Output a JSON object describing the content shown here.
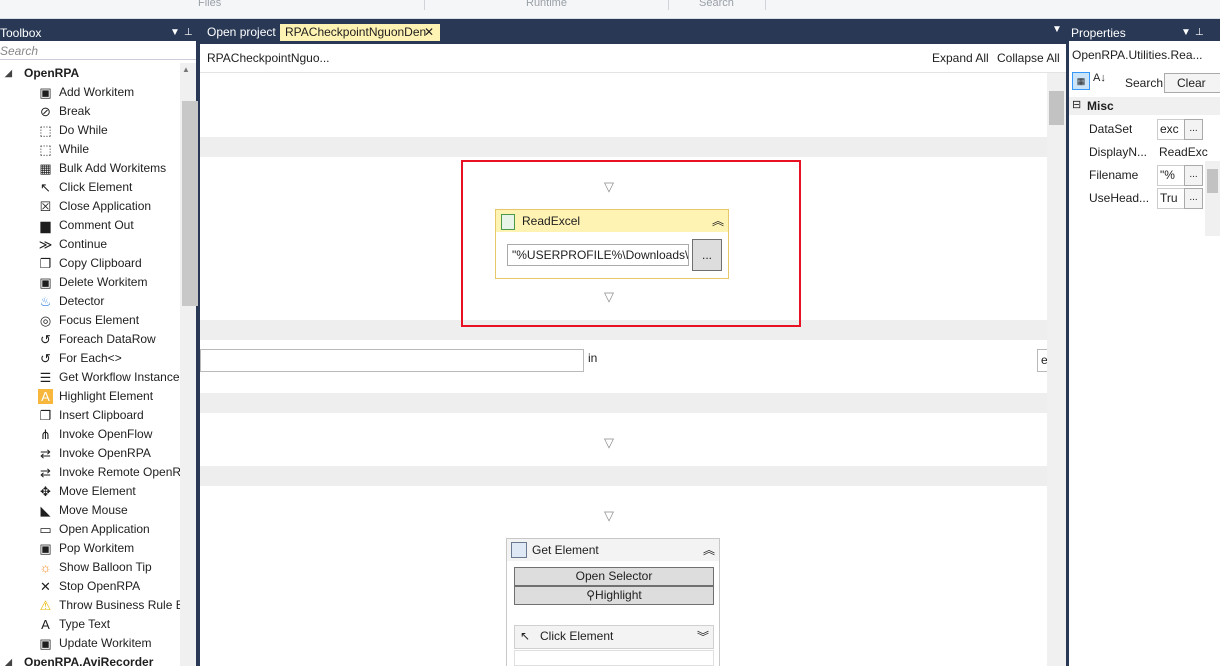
{
  "ribbon": {
    "groups": [
      "Files",
      "Runtime",
      "Search"
    ]
  },
  "toolbox": {
    "title": "Toolbox",
    "search_placeholder": "Search",
    "category": "OpenRPA",
    "next_category": "OpenRPA.AviRecorder",
    "items": [
      {
        "label": "Add Workitem",
        "icon": "add-workitem-icon"
      },
      {
        "label": "Break",
        "icon": "break-icon"
      },
      {
        "label": "Do While",
        "icon": "do-while-icon"
      },
      {
        "label": "While",
        "icon": "while-icon"
      },
      {
        "label": "Bulk Add Workitems",
        "icon": "bulk-add-icon"
      },
      {
        "label": "Click Element",
        "icon": "click-element-icon"
      },
      {
        "label": "Close Application",
        "icon": "close-application-icon"
      },
      {
        "label": "Comment Out",
        "icon": "comment-out-icon"
      },
      {
        "label": "Continue",
        "icon": "continue-icon"
      },
      {
        "label": "Copy Clipboard",
        "icon": "copy-clipboard-icon"
      },
      {
        "label": "Delete Workitem",
        "icon": "delete-workitem-icon"
      },
      {
        "label": "Detector",
        "icon": "detector-icon"
      },
      {
        "label": "Focus Element",
        "icon": "focus-element-icon"
      },
      {
        "label": "Foreach DataRow",
        "icon": "foreach-datarow-icon"
      },
      {
        "label": "For Each<>",
        "icon": "for-each-icon"
      },
      {
        "label": "Get Workflow Instance",
        "icon": "get-workflow-instance-icon"
      },
      {
        "label": "Highlight Element",
        "icon": "highlight-element-icon"
      },
      {
        "label": "Insert Clipboard",
        "icon": "insert-clipboard-icon"
      },
      {
        "label": "Invoke OpenFlow",
        "icon": "invoke-openflow-icon"
      },
      {
        "label": "Invoke OpenRPA",
        "icon": "invoke-openrpa-icon"
      },
      {
        "label": "Invoke Remote OpenRPA",
        "icon": "invoke-remote-openrpa-icon"
      },
      {
        "label": "Move Element",
        "icon": "move-element-icon"
      },
      {
        "label": "Move Mouse",
        "icon": "move-mouse-icon"
      },
      {
        "label": "Open Application",
        "icon": "open-application-icon"
      },
      {
        "label": "Pop Workitem",
        "icon": "pop-workitem-icon"
      },
      {
        "label": "Show Balloon Tip",
        "icon": "show-balloon-tip-icon"
      },
      {
        "label": "Stop OpenRPA",
        "icon": "stop-openrpa-icon"
      },
      {
        "label": "Throw Business Rule Exception",
        "icon": "warning-icon"
      },
      {
        "label": "Type Text",
        "icon": "type-text-icon"
      },
      {
        "label": "Update Workitem",
        "icon": "update-workitem-icon"
      }
    ]
  },
  "tabs": {
    "open_project": "Open project",
    "active": "RPACheckpointNguonDen",
    "close_glyph": "✕"
  },
  "designer": {
    "breadcrumb": "RPACheckpointNguo...",
    "expand_all": "Expand All",
    "collapse_all": "Collapse All",
    "foreach_in": "in",
    "foreach_right_value": "e",
    "read_excel": {
      "title": "ReadExcel",
      "filename": "\"%USERPROFILE%\\Downloads\\",
      "browse": "..."
    },
    "get_element": {
      "title": "Get Element",
      "open_selector": "Open Selector",
      "highlight": "Highlight"
    },
    "click_element": {
      "title": "Click Element"
    }
  },
  "properties": {
    "title": "Properties",
    "object": "OpenRPA.Utilities.Rea...",
    "search_label": "Search:",
    "clear": "Clear",
    "category": "Misc",
    "rows": [
      {
        "name": "DataSet",
        "value": "exc"
      },
      {
        "name": "DisplayN...",
        "value": "ReadExc"
      },
      {
        "name": "Filename",
        "value": "\"%"
      },
      {
        "name": "UseHead...",
        "value": "Tru"
      }
    ],
    "ellipsis": "..."
  },
  "colors": {
    "chrome": "#293955",
    "activity_header": "#fff3b4",
    "highlight_border": "#e81123"
  }
}
